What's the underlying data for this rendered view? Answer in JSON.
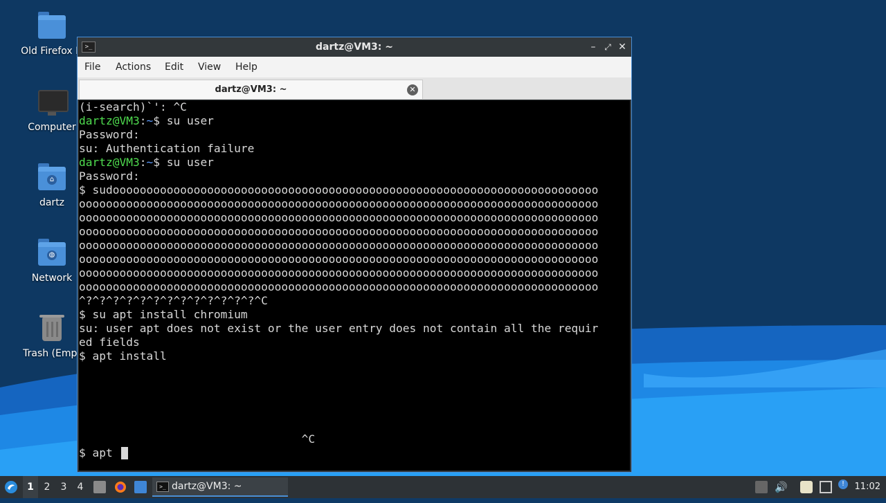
{
  "desktop": {
    "icons": [
      {
        "label": "Old Firefox D",
        "icon": "folder-icon"
      },
      {
        "label": "Computer",
        "icon": "computer-icon"
      },
      {
        "label": "dartz",
        "icon": "home-folder-icon"
      },
      {
        "label": "Network",
        "icon": "network-folder-icon"
      },
      {
        "label": "Trash (Empt",
        "icon": "trash-icon"
      }
    ]
  },
  "window": {
    "title": "dartz@VM3: ~",
    "menu": [
      "File",
      "Actions",
      "Edit",
      "View",
      "Help"
    ],
    "tab": {
      "label": "dartz@VM3: ~"
    },
    "terminal": {
      "lines": [
        {
          "text": "(i-search)`': ^C"
        },
        {
          "user": "dartz@VM3",
          "path": "~",
          "cmd": "$ su user"
        },
        {
          "text": "Password:"
        },
        {
          "text": "su: Authentication failure"
        },
        {
          "user": "dartz@VM3",
          "path": "~",
          "cmd": "$ su user"
        },
        {
          "text": "Password:"
        },
        {
          "text": "$ sudoooooooooooooooooooooooooooooooooooooooooooooooooooooooooooooooooooooooo"
        },
        {
          "text": "ooooooooooooooooooooooooooooooooooooooooooooooooooooooooooooooooooooooooooooo"
        },
        {
          "text": "ooooooooooooooooooooooooooooooooooooooooooooooooooooooooooooooooooooooooooooo"
        },
        {
          "text": "ooooooooooooooooooooooooooooooooooooooooooooooooooooooooooooooooooooooooooooo"
        },
        {
          "text": "ooooooooooooooooooooooooooooooooooooooooooooooooooooooooooooooooooooooooooooo"
        },
        {
          "text": "ooooooooooooooooooooooooooooooooooooooooooooooooooooooooooooooooooooooooooooo"
        },
        {
          "text": "ooooooooooooooooooooooooooooooooooooooooooooooooooooooooooooooooooooooooooooo"
        },
        {
          "text": "ooooooooooooooooooooooooooooooooooooooooooooooooooooooooooooooooooooooooooooo"
        },
        {
          "text": "^?^?^?^?^?^?^?^?^?^?^?^?^?^C"
        },
        {
          "text": "$ su apt install chromium"
        },
        {
          "text": "su: user apt does not exist or the user entry does not contain all the requir"
        },
        {
          "text": "ed fields"
        },
        {
          "text": "$ apt install"
        },
        {
          "text": ""
        },
        {
          "text": ""
        },
        {
          "text": ""
        },
        {
          "text": "                                 ^C"
        },
        {
          "text": "$ apt "
        }
      ]
    }
  },
  "taskbar": {
    "workspaces": [
      "1",
      "2",
      "3",
      "4"
    ],
    "active_workspace": "1",
    "task_label": "dartz@VM3: ~",
    "clock": "11:02"
  }
}
